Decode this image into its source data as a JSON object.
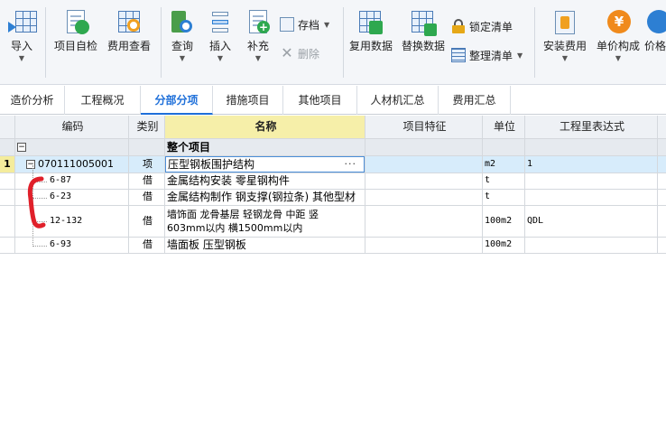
{
  "toolbar": {
    "import": "导入",
    "self_check": "项目自检",
    "cost_view": "费用查看",
    "query": "查询",
    "insert": "插入",
    "supplement": "补充",
    "archive": "存档",
    "delete": "删除",
    "reuse_data": "复用数据",
    "replace_data": "替换数据",
    "lock_list": "锁定清单",
    "organize_list": "整理清单",
    "install_fee": "安装费用",
    "unit_price": "单价构成",
    "price": "价格"
  },
  "tabs": [
    "造价分析",
    "工程概况",
    "分部分项",
    "措施项目",
    "其他项目",
    "人材机汇总",
    "费用汇总"
  ],
  "active_tab": "分部分项",
  "columns": {
    "code": "编码",
    "type": "类别",
    "name": "名称",
    "feature": "项目特征",
    "unit": "单位",
    "quantity_expr": "工程里表达式"
  },
  "group_row": {
    "name": "整个项目"
  },
  "rows": [
    {
      "num": "1",
      "code": "070111005001",
      "type": "项",
      "name": "压型钢板围护结构",
      "unit": "m2",
      "expr": "1"
    },
    {
      "code": "6-87",
      "type": "借",
      "name": "金属结构安装 零星钢构件",
      "unit": "t",
      "expr": ""
    },
    {
      "code": "6-23",
      "type": "借",
      "name": "金属结构制作 钢支撑(钢拉条) 其他型材",
      "unit": "t",
      "expr": ""
    },
    {
      "code": "12-132",
      "type": "借",
      "name_line1": "墙饰面 龙骨基层 轻钢龙骨 中距 竖",
      "name_line2": "603mm以内 横1500mm以内",
      "unit": "100m2",
      "expr": "QDL"
    },
    {
      "code": "6-93",
      "type": "借",
      "name": "墙面板 压型钢板",
      "unit": "100m2",
      "expr": ""
    }
  ],
  "ellipsis": "···",
  "expand_minus": "−",
  "colors": {
    "accent": "#1e6fd9",
    "selected_row": "#d7ecfb",
    "name_header": "#f6efa9",
    "annotation": "#e0202a"
  }
}
